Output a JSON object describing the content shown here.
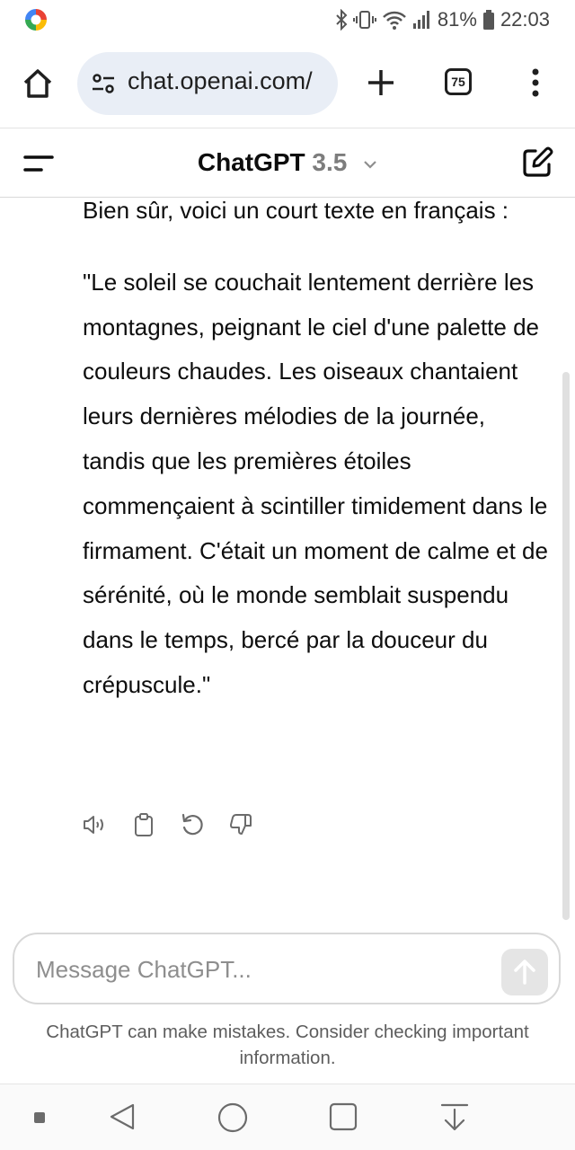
{
  "status_bar": {
    "battery": "81%",
    "time": "22:03"
  },
  "browser": {
    "url": "chat.openai.com/",
    "tab_count": "75"
  },
  "app": {
    "title": "ChatGPT",
    "version": "3.5"
  },
  "message": {
    "paragraphs": [
      "Bien sûr, voici un court texte en français :",
      "\"Le soleil se couchait lentement derrière les montagnes, peignant le ciel d'une palette de couleurs chaudes. Les oiseaux chantaient leurs dernières mélodies de la journée, tandis que les premières étoiles commençaient à scintiller timidement dans le firmament. C'était un moment de calme et de sérénité, où le monde semblait suspendu dans le temps, bercé par la douceur du crépuscule.\""
    ],
    "actions": [
      "speaker-icon",
      "clipboard-icon",
      "regenerate-icon",
      "thumbs-down-icon"
    ]
  },
  "composer": {
    "placeholder": "Message ChatGPT..."
  },
  "disclaimer": "ChatGPT can make mistakes. Consider checking important information.",
  "colors": {
    "url_bg": "#e9eef6",
    "text": "#0d0d0d",
    "version_gray": "#7d7d7d"
  }
}
